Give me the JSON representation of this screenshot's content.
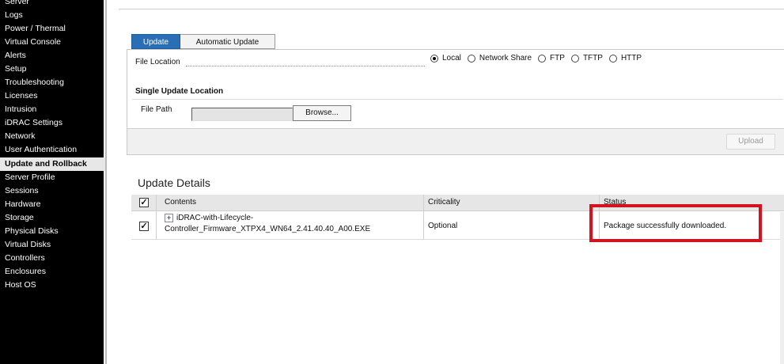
{
  "sidebar": {
    "items": [
      {
        "label": "Server",
        "active": false
      },
      {
        "label": "Logs",
        "active": false
      },
      {
        "label": "Power / Thermal",
        "active": false
      },
      {
        "label": "Virtual Console",
        "active": false
      },
      {
        "label": "Alerts",
        "active": false
      },
      {
        "label": "Setup",
        "active": false
      },
      {
        "label": "Troubleshooting",
        "active": false
      },
      {
        "label": "Licenses",
        "active": false
      },
      {
        "label": "Intrusion",
        "active": false
      },
      {
        "label": "iDRAC Settings",
        "active": false
      },
      {
        "label": "Network",
        "active": false
      },
      {
        "label": "User Authentication",
        "active": false
      },
      {
        "label": "Update and Rollback",
        "active": true
      },
      {
        "label": "Server Profile",
        "active": false
      },
      {
        "label": "Sessions",
        "active": false
      },
      {
        "label": "Hardware",
        "active": false
      },
      {
        "label": "Storage",
        "active": false
      },
      {
        "label": "Physical Disks",
        "active": false
      },
      {
        "label": "Virtual Disks",
        "active": false
      },
      {
        "label": "Controllers",
        "active": false
      },
      {
        "label": "Enclosures",
        "active": false
      },
      {
        "label": "Host OS",
        "active": false
      }
    ]
  },
  "tabs": {
    "update": "Update",
    "automatic_update": "Automatic Update"
  },
  "file_location": {
    "label": "File Location",
    "options": [
      "Local",
      "Network Share",
      "FTP",
      "TFTP",
      "HTTP"
    ],
    "selected": "Local"
  },
  "single_update": {
    "heading": "Single Update Location",
    "file_path_label": "File Path",
    "file_path_value": "",
    "browse_label": "Browse...",
    "upload_label": "Upload"
  },
  "update_details": {
    "title": "Update Details",
    "columns": [
      "Contents",
      "Criticality",
      "Status"
    ],
    "rows": [
      {
        "checked": true,
        "contents_line1": "iDRAC-with-Lifecycle-",
        "contents_line2": "Controller_Firmware_XTPX4_WN64_2.41.40.40_A00.EXE",
        "criticality": "Optional",
        "status": "Package successfully downloaded."
      }
    ]
  },
  "colors": {
    "active_tab": "#2a6fb5",
    "highlight": "#d4131e",
    "sidebar_bg": "#000000"
  }
}
